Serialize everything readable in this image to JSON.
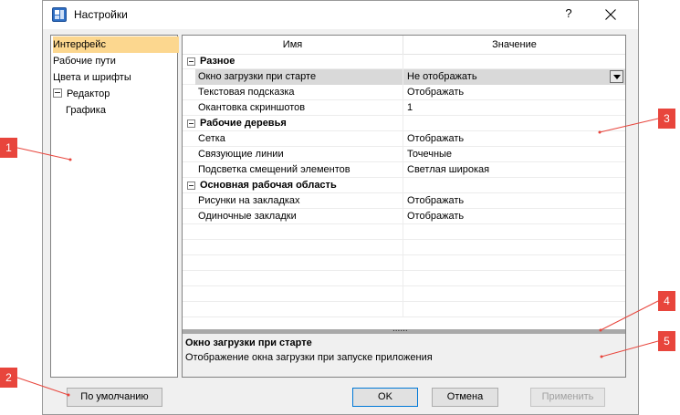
{
  "window": {
    "title": "Настройки",
    "help_label": "?"
  },
  "nav": {
    "items": [
      {
        "label": "Интерфейс",
        "selected": true,
        "indent": 0
      },
      {
        "label": "Рабочие пути",
        "selected": false,
        "indent": 0
      },
      {
        "label": "Цвета и шрифты",
        "selected": false,
        "indent": 0
      },
      {
        "label": "Редактор",
        "selected": false,
        "indent": 0,
        "expanded": true
      },
      {
        "label": "Графика",
        "selected": false,
        "indent": 1
      }
    ]
  },
  "grid": {
    "columns": [
      "Имя",
      "Значение"
    ],
    "categories": [
      {
        "label": "Разное",
        "rows": [
          {
            "name": "Окно загрузки при старте",
            "value": "Не отображать",
            "selected": true
          },
          {
            "name": "Текстовая подсказка",
            "value": "Отображать"
          },
          {
            "name": "Окантовка скриншотов",
            "value": "1"
          }
        ]
      },
      {
        "label": "Рабочие деревья",
        "rows": [
          {
            "name": "Сетка",
            "value": "Отображать"
          },
          {
            "name": "Связующие линии",
            "value": "Точечные"
          },
          {
            "name": "Подсветка смещений элементов",
            "value": "Светлая широкая"
          }
        ]
      },
      {
        "label": "Основная рабочая область",
        "rows": [
          {
            "name": "Рисунки на закладках",
            "value": "Отображать"
          },
          {
            "name": "Одиночные закладки",
            "value": "Отображать"
          }
        ]
      }
    ],
    "splitter_grip": "......"
  },
  "description": {
    "title": "Окно загрузки при старте",
    "text": "Отображение окна загрузки при запуске приложения"
  },
  "buttons": {
    "defaults": "По умолчанию",
    "ok": "OK",
    "cancel": "Отмена",
    "apply": "Применить"
  },
  "callouts": [
    "1",
    "2",
    "3",
    "4",
    "5"
  ],
  "colors": {
    "selection": "#fcd78f",
    "callout": "#e8453c",
    "focus_border": "#0078d7"
  }
}
